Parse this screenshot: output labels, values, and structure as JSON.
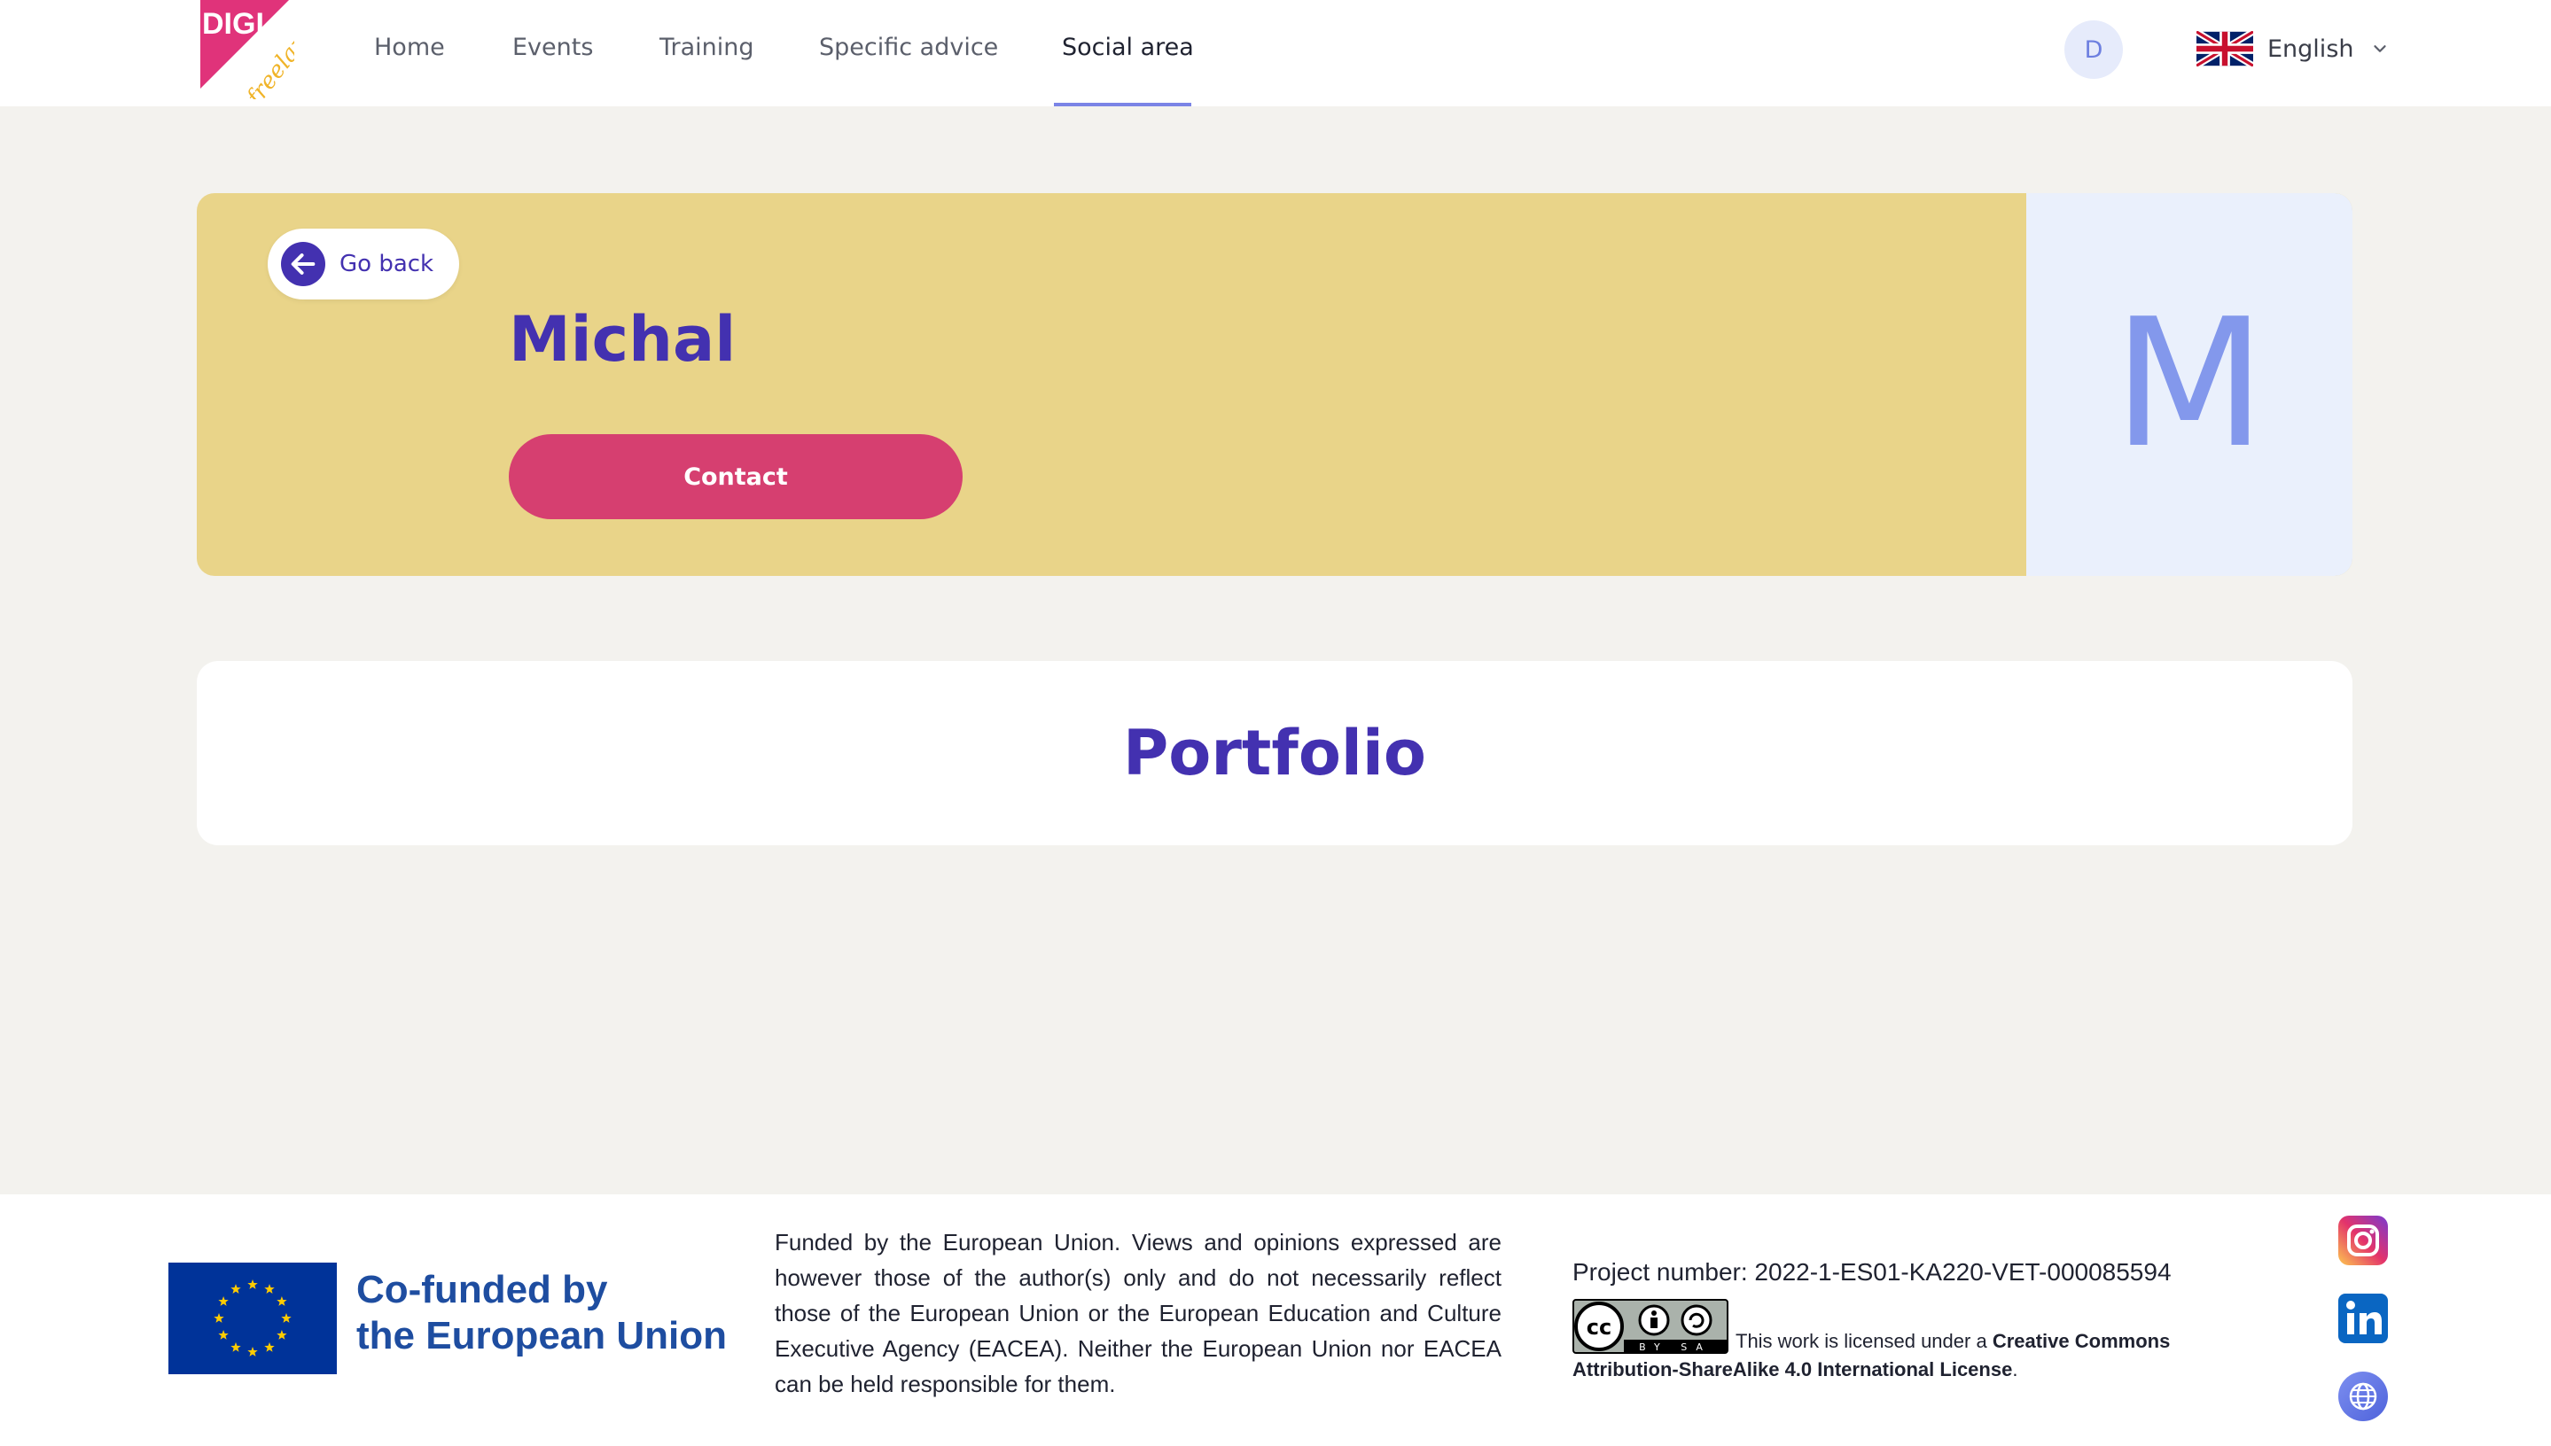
{
  "brand": {
    "logo_top": "DIGI",
    "logo_bottom": "freelancer",
    "logo_color": "#e0337a",
    "logo_accent": "#f0b429"
  },
  "nav": {
    "items": [
      {
        "label": "Home"
      },
      {
        "label": "Events"
      },
      {
        "label": "Training"
      },
      {
        "label": "Specific advice"
      },
      {
        "label": "Social area",
        "active": true
      }
    ],
    "user_initial": "D",
    "language": {
      "label": "English",
      "icon": "uk-flag-icon"
    }
  },
  "profile": {
    "go_back_label": "Go back",
    "name": "Michal",
    "contact_label": "Contact",
    "initial": "M",
    "card_color": "#e9d489",
    "accent": "#4331b0",
    "button_color": "#d63f70"
  },
  "portfolio": {
    "title": "Portfolio"
  },
  "footer": {
    "eu_line1": "Co-funded by",
    "eu_line2": "the European Union",
    "disclaimer": "Funded by the European Union. Views and opinions expressed are however those of the author(s) only and do not necessarily reflect those of the European Union or the European Education and Culture Executive Agency (EACEA). Neither the European Union nor EACEA can be held responsible for them.",
    "project_number": "Project number: 2022-1-ES01-KA220-VET-000085594",
    "license_prefix": "This work is licensed under a",
    "license_name_1": "Creative Commons",
    "license_name_2": "Attribution-ShareAlike 4.0 International License",
    "license_suffix": ".",
    "cc_badge_text": "BY SA",
    "social": [
      "instagram-icon",
      "linkedin-icon",
      "globe-icon"
    ]
  }
}
